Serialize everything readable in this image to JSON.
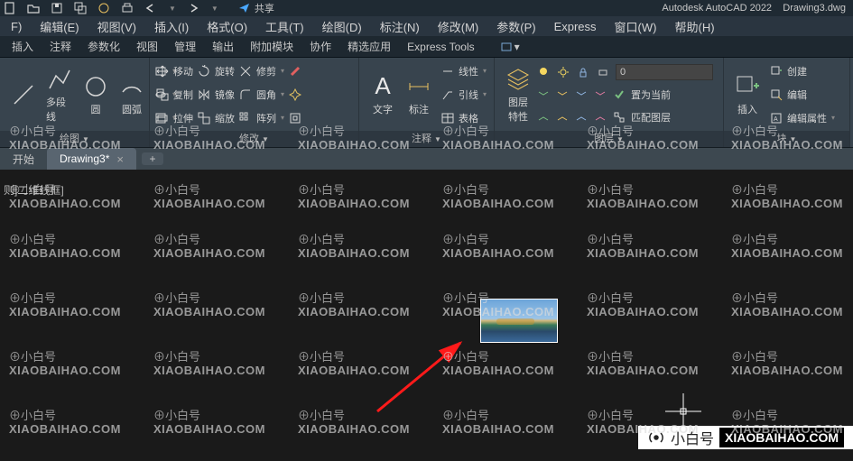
{
  "title": {
    "app": "Autodesk AutoCAD 2022",
    "file": "Drawing3.dwg"
  },
  "share": "共享",
  "menu": [
    "F)",
    "编辑(E)",
    "视图(V)",
    "插入(I)",
    "格式(O)",
    "工具(T)",
    "绘图(D)",
    "标注(N)",
    "修改(M)",
    "参数(P)",
    "Express",
    "窗口(W)",
    "帮助(H)"
  ],
  "ribbon_tabs": [
    "插入",
    "注释",
    "参数化",
    "视图",
    "管理",
    "输出",
    "附加模块",
    "协作",
    "精选应用",
    "Express Tools"
  ],
  "panels": {
    "draw": {
      "title": "绘图",
      "polyline": "多段线",
      "circle": "圆",
      "arc": "圆弧"
    },
    "modify": {
      "title": "修改",
      "move": "移动",
      "rotate": "旋转",
      "trim": "修剪",
      "copy": "复制",
      "mirror": "镜像",
      "fillet": "圆角",
      "stretch": "拉伸",
      "scale": "缩放",
      "array": "阵列"
    },
    "annot": {
      "title": "注释",
      "text": "文字",
      "dim": "标注",
      "table": "表格",
      "linear": "线性",
      "leader": "引线"
    },
    "layer": {
      "title": "图层",
      "props": "图层\n特性",
      "current": "置为当前",
      "match": "匹配图层",
      "trans_value": "0"
    },
    "block": {
      "title": "块",
      "insert": "插入",
      "create": "创建",
      "edit": "编辑",
      "editattr": "编辑属性"
    }
  },
  "file_tabs": {
    "start": "开始",
    "active": "Drawing3*"
  },
  "cmd_hint": "则]二维线框]",
  "watermark_cn_prefix": "⊕小白号",
  "watermark_en": "XIAOBAIHAO.COM",
  "float_status": {
    "label": "小白号",
    "domain": "XIAOBAIHAO.COM"
  }
}
